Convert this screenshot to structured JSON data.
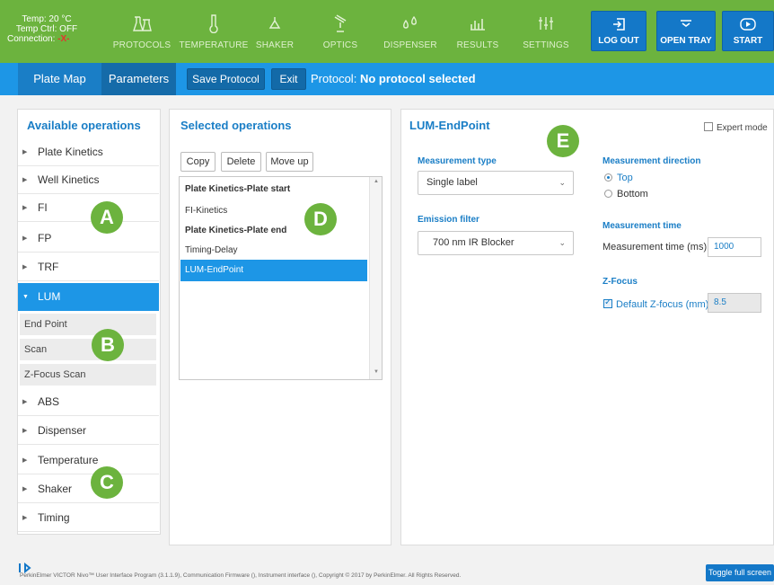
{
  "status": {
    "temp": "Temp: 20 °C",
    "temp_ctrl": "Temp Ctrl: OFF",
    "connection_label": "Connection:",
    "connection_value": "-X-"
  },
  "nav": [
    {
      "label": "PROTOCOLS",
      "icon": "flask-icon"
    },
    {
      "label": "TEMPERATURE",
      "icon": "thermometer-icon"
    },
    {
      "label": "SHAKER",
      "icon": "shaker-icon"
    },
    {
      "label": "OPTICS",
      "icon": "optics-icon"
    },
    {
      "label": "DISPENSER",
      "icon": "drops-icon"
    },
    {
      "label": "RESULTS",
      "icon": "bar-chart-icon"
    },
    {
      "label": "SETTINGS",
      "icon": "sliders-icon"
    }
  ],
  "actions": {
    "logout": "LOG OUT",
    "open_tray": "OPEN TRAY",
    "start": "START"
  },
  "toolbar": {
    "tab_platemap": "Plate Map",
    "tab_parameters": "Parameters",
    "save": "Save Protocol",
    "exit": "Exit",
    "protocol_prefix": "Protocol:",
    "protocol_name": "No protocol selected"
  },
  "available": {
    "title": "Available operations",
    "items_top": [
      "Plate Kinetics",
      "Well Kinetics",
      "FI",
      "FP",
      "TRF"
    ],
    "active": "LUM",
    "sub_items": [
      "End Point",
      "Scan",
      "Z-Focus Scan"
    ],
    "items_bottom": [
      "ABS",
      "Dispenser",
      "Temperature",
      "Shaker",
      "Timing"
    ]
  },
  "selected": {
    "title": "Selected operations",
    "copy": "Copy",
    "delete": "Delete",
    "move_up": "Move up",
    "rows": [
      {
        "label": "Plate Kinetics-Plate start",
        "bold": true
      },
      {
        "label": "FI-Kinetics",
        "bold": false
      },
      {
        "label": "Plate Kinetics-Plate end",
        "bold": true
      },
      {
        "label": "Timing-Delay",
        "bold": false
      },
      {
        "label": "LUM-EndPoint",
        "bold": false,
        "selected": true
      }
    ]
  },
  "detail": {
    "title": "LUM-EndPoint",
    "expert_mode": "Expert mode",
    "measurement_type_label": "Measurement type",
    "measurement_type_value": "Single label",
    "emission_filter_label": "Emission filter",
    "emission_filter_value": "700 nm IR Blocker",
    "direction_label": "Measurement direction",
    "direction_top": "Top",
    "direction_bottom": "Bottom",
    "time_label": "Measurement time",
    "time_field_label": "Measurement time (ms)",
    "time_value": "1000",
    "zfocus_label": "Z-Focus",
    "zfocus_default_label": "Default Z-focus (mm)",
    "zfocus_value": "8.5"
  },
  "markers": [
    "A",
    "B",
    "C",
    "D",
    "E"
  ],
  "footer": {
    "brand": "PerkinElmer",
    "text": "PerkinElmer VICTOR Nivo™ User Interface Program (3.1.1.9), Communication Firmware (), Instrument interface (), Copyright © 2017 by PerkinElmer. All Rights Reserved.",
    "toggle": "Toggle full screen"
  },
  "colors": {
    "green": "#6cb33e",
    "blue": "#1d96e6",
    "dark_blue": "#1478c8",
    "title_blue": "#1a7ec6"
  }
}
